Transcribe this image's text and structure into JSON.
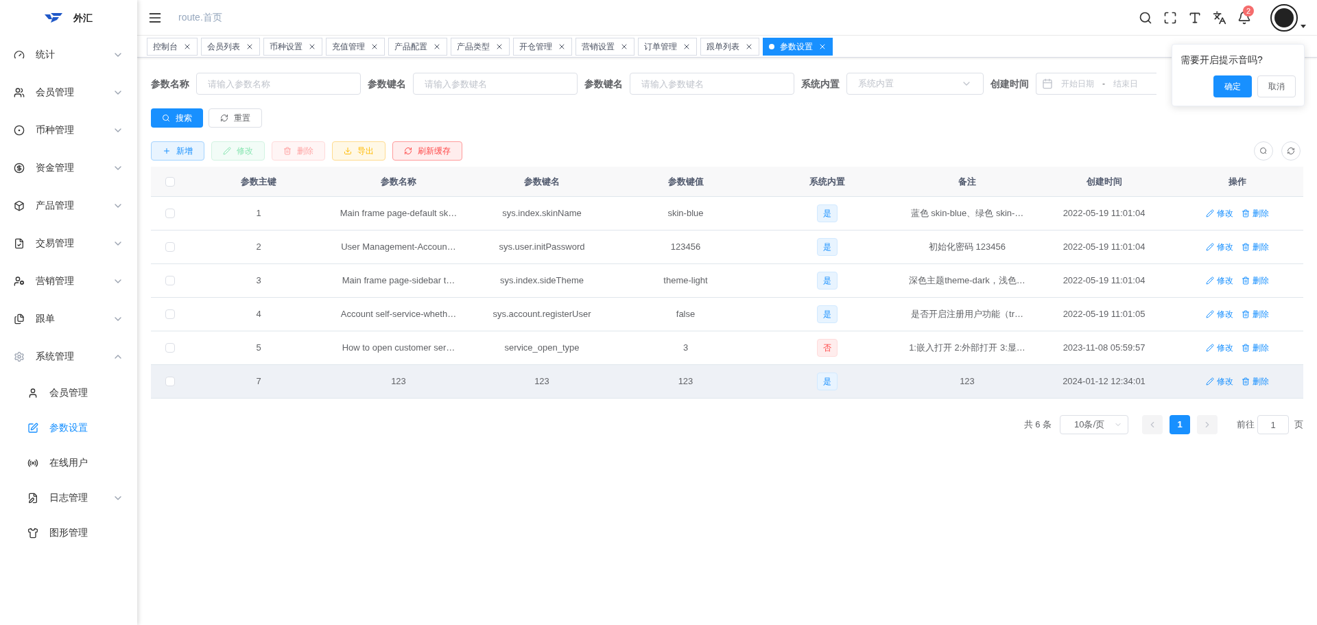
{
  "logo": {
    "text": "外汇"
  },
  "sidebar": {
    "items": [
      {
        "label": "统计",
        "expanded": false
      },
      {
        "label": "会员管理",
        "expanded": false
      },
      {
        "label": "币种管理",
        "expanded": false
      },
      {
        "label": "资金管理",
        "expanded": false
      },
      {
        "label": "产品管理",
        "expanded": false
      },
      {
        "label": "交易管理",
        "expanded": false
      },
      {
        "label": "营销管理",
        "expanded": false
      },
      {
        "label": "跟单",
        "expanded": false
      },
      {
        "label": "系统管理",
        "expanded": true,
        "children": [
          {
            "label": "会员管理",
            "selected": false
          },
          {
            "label": "参数设置",
            "selected": true
          },
          {
            "label": "在线用户",
            "selected": false
          },
          {
            "label": "日志管理",
            "selected": false,
            "expanded": false
          },
          {
            "label": "图形管理",
            "selected": false
          }
        ]
      }
    ]
  },
  "header": {
    "breadcrumb": "route.首页",
    "notification_count": "2"
  },
  "tabs": [
    {
      "label": "控制台",
      "selected": false
    },
    {
      "label": "会员列表",
      "selected": false
    },
    {
      "label": "币种设置",
      "selected": false
    },
    {
      "label": "充值管理",
      "selected": false
    },
    {
      "label": "产品配置",
      "selected": false
    },
    {
      "label": "产品类型",
      "selected": false
    },
    {
      "label": "开仓管理",
      "selected": false
    },
    {
      "label": "营销设置",
      "selected": false
    },
    {
      "label": "订单管理",
      "selected": false
    },
    {
      "label": "跟单列表",
      "selected": false
    },
    {
      "label": "参数设置",
      "selected": true
    }
  ],
  "search_form": {
    "fields": [
      {
        "kind": "text",
        "label": "参数名称",
        "placeholder": "请输入参数名称"
      },
      {
        "kind": "text",
        "label": "参数键名",
        "placeholder": "请输入参数键名"
      },
      {
        "kind": "text",
        "label": "参数键名",
        "placeholder": "请输入参数键名"
      },
      {
        "kind": "select",
        "label": "系统内置",
        "placeholder": "系统内置"
      },
      {
        "kind": "daterange",
        "label": "创建时间",
        "start_placeholder": "开始日期",
        "separator": "-",
        "end_placeholder": "结束日"
      }
    ],
    "search_button": "搜索",
    "reset_button": "重置"
  },
  "toolbar": [
    {
      "kind": "add",
      "label": "新增",
      "disabled": false
    },
    {
      "kind": "edit",
      "label": "修改",
      "disabled": true
    },
    {
      "kind": "delete",
      "label": "删除",
      "disabled": true
    },
    {
      "kind": "export",
      "label": "导出",
      "disabled": false
    },
    {
      "kind": "refresh",
      "label": "刷新缓存",
      "disabled": false
    }
  ],
  "table": {
    "all_checked": false,
    "columns": [
      "参数主键",
      "参数名称",
      "参数键名",
      "参数键值",
      "系统内置",
      "备注",
      "创建时间",
      "操作"
    ],
    "rows": [
      {
        "checked": false,
        "highlighted": false,
        "id": "1",
        "name": "Main frame page-default sk…",
        "key": "sys.index.skinName",
        "value": "skin-blue",
        "builtin": true,
        "builtin_text": "是",
        "remark": "蓝色 skin-blue、绿色 skin-…",
        "created": "2022-05-19 11:01:04",
        "edit": "修改",
        "delete": "删除"
      },
      {
        "checked": false,
        "highlighted": false,
        "id": "2",
        "name": "User Management-Accoun…",
        "key": "sys.user.initPassword",
        "value": "123456",
        "builtin": true,
        "builtin_text": "是",
        "remark": "初始化密码 123456",
        "created": "2022-05-19 11:01:04",
        "edit": "修改",
        "delete": "删除"
      },
      {
        "checked": false,
        "highlighted": false,
        "id": "3",
        "name": "Main frame page-sidebar t…",
        "key": "sys.index.sideTheme",
        "value": "theme-light",
        "builtin": true,
        "builtin_text": "是",
        "remark": "深色主题theme-dark，浅色…",
        "created": "2022-05-19 11:01:04",
        "edit": "修改",
        "delete": "删除"
      },
      {
        "checked": false,
        "highlighted": false,
        "id": "4",
        "name": "Account self-service-wheth…",
        "key": "sys.account.registerUser",
        "value": "false",
        "builtin": true,
        "builtin_text": "是",
        "remark": "是否开启注册用户功能（tr…",
        "created": "2022-05-19 11:01:05",
        "edit": "修改",
        "delete": "删除"
      },
      {
        "checked": false,
        "highlighted": false,
        "id": "5",
        "name": "How to open customer ser…",
        "key": "service_open_type",
        "value": "3",
        "builtin": false,
        "builtin_text": "否",
        "remark": "1:嵌入打开 2:外部打开 3:显…",
        "created": "2023-11-08 05:59:57",
        "edit": "修改",
        "delete": "删除"
      },
      {
        "checked": false,
        "highlighted": true,
        "id": "7",
        "name": "123",
        "key": "123",
        "value": "123",
        "builtin": true,
        "builtin_text": "是",
        "remark": "123",
        "created": "2024-01-12 12:34:01",
        "edit": "修改",
        "delete": "删除"
      }
    ]
  },
  "pagination": {
    "total": "共 6 条",
    "page_size": "10条/页",
    "pages": [
      {
        "label": "1",
        "selected": true
      }
    ],
    "goto_label": "前往",
    "goto_value": "1",
    "goto_suffix": "页"
  },
  "popover": {
    "message": "需要开启提示音吗?",
    "confirm": "确定",
    "cancel": "取消"
  }
}
